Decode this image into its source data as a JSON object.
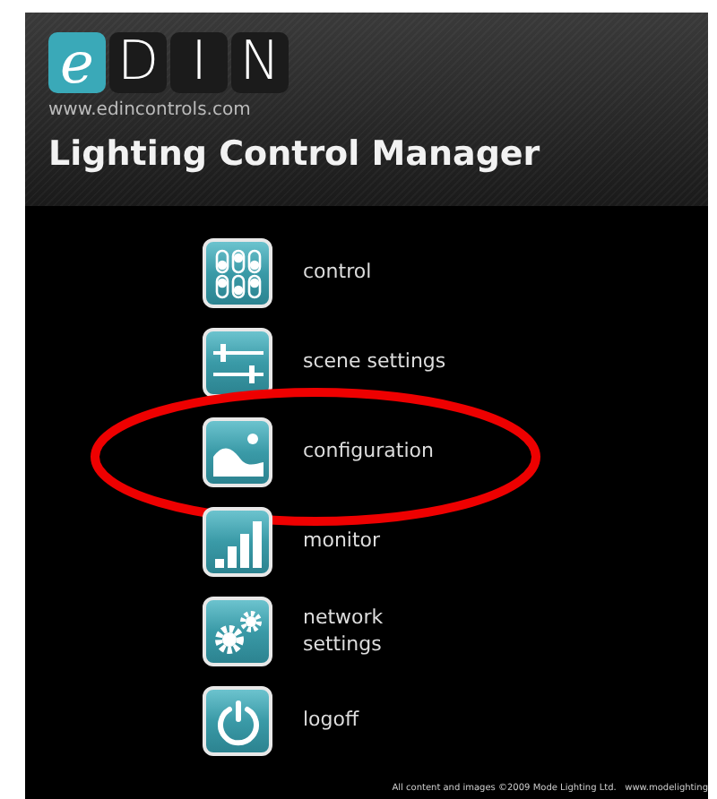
{
  "logo": {
    "letters": [
      "e",
      "D",
      "I",
      "N"
    ],
    "url": "www.edincontrols.com"
  },
  "title": "Lighting Control Manager",
  "menu": [
    {
      "kind": "control",
      "label": "control",
      "circled": false
    },
    {
      "kind": "sliders",
      "label": "scene settings",
      "circled": false
    },
    {
      "kind": "image",
      "label": "configuration",
      "circled": true
    },
    {
      "kind": "bars",
      "label": "monitor",
      "circled": false
    },
    {
      "kind": "gears",
      "label": "network\nsettings",
      "circled": false
    },
    {
      "kind": "power",
      "label": "logoff",
      "circled": false
    }
  ],
  "footer": "All content and images ©2009 Mode Lighting Ltd.   www.modelighting"
}
